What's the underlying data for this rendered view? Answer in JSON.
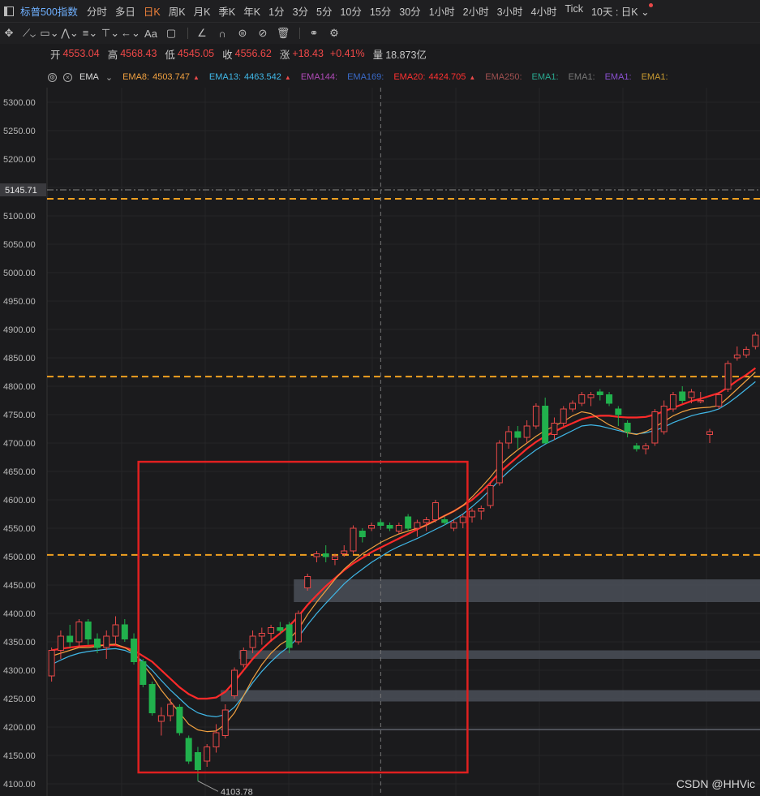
{
  "toolbar": {
    "title": "标普500指数",
    "timeframes": [
      "分时",
      "多日",
      "日K",
      "周K",
      "月K",
      "季K",
      "年K",
      "1分",
      "3分",
      "5分",
      "10分",
      "15分",
      "30分",
      "1小时",
      "2小时",
      "3小时",
      "4小时",
      "Tick"
    ],
    "active_timeframe": "日K",
    "range": "10天 : 日K"
  },
  "tools": [
    "move-icon",
    "line-icon",
    "rect-icon",
    "pattern-icon",
    "channel-icon",
    "fib-icon",
    "arrow-icon",
    "text-icon",
    "comment-icon",
    "ruler-icon",
    "magnet-icon",
    "visibility-icon",
    "hide-icon",
    "trash-icon",
    "link-icon",
    "settings-icon"
  ],
  "quote": {
    "open_label": "开",
    "open": "4553.04",
    "high_label": "高",
    "high": "4568.43",
    "low_label": "低",
    "low": "4545.05",
    "close_label": "收",
    "close": "4556.62",
    "change_label": "涨",
    "change": "+18.43",
    "change_pct": "+0.41%",
    "volume_label": "量",
    "volume": "18.873亿"
  },
  "indicator": {
    "name": "EMA",
    "items": [
      {
        "label": "EMA8:",
        "value": "4503.747",
        "color": "#f0a040",
        "arrow": true
      },
      {
        "label": "EMA13:",
        "value": "4463.542",
        "color": "#40b8e8",
        "arrow": true
      },
      {
        "label": "EMA144:",
        "value": "",
        "color": "#b04ab8",
        "arrow": false
      },
      {
        "label": "EMA169:",
        "value": "",
        "color": "#3a6ac8",
        "arrow": false
      },
      {
        "label": "EMA20:",
        "value": "4424.705",
        "color": "#ff3030",
        "arrow": true
      },
      {
        "label": "EMA250:",
        "value": "",
        "color": "#a05050",
        "arrow": false
      },
      {
        "label": "EMA1:",
        "value": "",
        "color": "#2aa890",
        "arrow": false
      },
      {
        "label": "EMA1:",
        "value": "",
        "color": "#777777",
        "arrow": false
      },
      {
        "label": "EMA1:",
        "value": "",
        "color": "#8a50d0",
        "arrow": false
      },
      {
        "label": "EMA1:",
        "value": "",
        "color": "#c89a30",
        "arrow": false
      }
    ]
  },
  "chart_data": {
    "type": "candlestick",
    "ylim": [
      4100,
      5300
    ],
    "yticks": [
      "5300.00",
      "5250.00",
      "5200.00",
      "5150.00",
      "5100.00",
      "5050.00",
      "5000.00",
      "4950.00",
      "4900.00",
      "4850.00",
      "4800.00",
      "4750.00",
      "4700.00",
      "4650.00",
      "4600.00",
      "4550.00",
      "4500.00",
      "4450.00",
      "4400.00",
      "4350.00",
      "4300.00",
      "4250.00",
      "4200.00",
      "4150.00",
      "4100.00"
    ],
    "current_price_label": "5145.71",
    "current_price": 5145.71,
    "low_annotation": "4103.78",
    "low_value": 4103.78,
    "up_color": "#e84848",
    "down_color": "#21b14d",
    "candles": [
      [
        4290,
        4340,
        4280,
        4335
      ],
      [
        4335,
        4370,
        4320,
        4360
      ],
      [
        4360,
        4380,
        4340,
        4350
      ],
      [
        4350,
        4390,
        4340,
        4385
      ],
      [
        4385,
        4390,
        4345,
        4355
      ],
      [
        4355,
        4365,
        4330,
        4340
      ],
      [
        4340,
        4370,
        4320,
        4360
      ],
      [
        4360,
        4395,
        4345,
        4380
      ],
      [
        4380,
        4390,
        4350,
        4355
      ],
      [
        4355,
        4365,
        4310,
        4315
      ],
      [
        4315,
        4320,
        4270,
        4275
      ],
      [
        4275,
        4280,
        4220,
        4225
      ],
      [
        4210,
        4235,
        4185,
        4220
      ],
      [
        4220,
        4250,
        4210,
        4240
      ],
      [
        4235,
        4240,
        4185,
        4190
      ],
      [
        4180,
        4185,
        4135,
        4140
      ],
      [
        4155,
        4165,
        4105,
        4125
      ],
      [
        4140,
        4170,
        4130,
        4165
      ],
      [
        4165,
        4205,
        4155,
        4190
      ],
      [
        4185,
        4240,
        4180,
        4230
      ],
      [
        4255,
        4305,
        4250,
        4300
      ],
      [
        4310,
        4340,
        4305,
        4335
      ],
      [
        4340,
        4370,
        4330,
        4360
      ],
      [
        4360,
        4375,
        4345,
        4365
      ],
      [
        4365,
        4380,
        4350,
        4375
      ],
      [
        4375,
        4385,
        4365,
        4370
      ],
      [
        4380,
        4385,
        4330,
        4340
      ],
      [
        4350,
        4405,
        4345,
        4400
      ],
      [
        4445,
        4470,
        4440,
        4465
      ],
      [
        4500,
        4510,
        4490,
        4505
      ],
      [
        4505,
        4520,
        4490,
        4500
      ],
      [
        4495,
        4505,
        4485,
        4500
      ],
      [
        4505,
        4520,
        4500,
        4510
      ],
      [
        4510,
        4555,
        4505,
        4550
      ],
      [
        4545,
        4550,
        4525,
        4535
      ],
      [
        4550,
        4560,
        4545,
        4555
      ],
      [
        4560,
        4565,
        4550,
        4555
      ],
      [
        4555,
        4560,
        4545,
        4550
      ],
      [
        4545,
        4560,
        4540,
        4555
      ],
      [
        4570,
        4575,
        4545,
        4550
      ],
      [
        4550,
        4565,
        4535,
        4560
      ],
      [
        4560,
        4570,
        4545,
        4565
      ],
      [
        4565,
        4600,
        4560,
        4595
      ],
      [
        4565,
        4570,
        4555,
        4560
      ],
      [
        4550,
        4565,
        4545,
        4560
      ],
      [
        4560,
        4575,
        4550,
        4570
      ],
      [
        4570,
        4585,
        4560,
        4580
      ],
      [
        4580,
        4590,
        4565,
        4585
      ],
      [
        4590,
        4630,
        4585,
        4625
      ],
      [
        4630,
        4705,
        4625,
        4700
      ],
      [
        4700,
        4730,
        4690,
        4720
      ],
      [
        4720,
        4730,
        4690,
        4710
      ],
      [
        4710,
        4740,
        4700,
        4730
      ],
      [
        4730,
        4770,
        4725,
        4765
      ],
      [
        4765,
        4780,
        4700,
        4700
      ],
      [
        4715,
        4745,
        4705,
        4735
      ],
      [
        4735,
        4765,
        4730,
        4760
      ],
      [
        4760,
        4775,
        4755,
        4770
      ],
      [
        4770,
        4790,
        4765,
        4785
      ],
      [
        4780,
        4790,
        4765,
        4785
      ],
      [
        4790,
        4795,
        4775,
        4785
      ],
      [
        4785,
        4790,
        4765,
        4770
      ],
      [
        4760,
        4765,
        4730,
        4750
      ],
      [
        4735,
        4740,
        4710,
        4720
      ],
      [
        4695,
        4700,
        4685,
        4690
      ],
      [
        4690,
        4700,
        4680,
        4695
      ],
      [
        4700,
        4760,
        4695,
        4755
      ],
      [
        4720,
        4775,
        4715,
        4765
      ],
      [
        4760,
        4790,
        4755,
        4785
      ],
      [
        4790,
        4800,
        4770,
        4775
      ],
      [
        4780,
        4795,
        4770,
        4790
      ],
      [
        4775,
        4790,
        4770,
        4775
      ],
      [
        4715,
        4725,
        4700,
        4720
      ],
      [
        4765,
        4790,
        4760,
        4785
      ],
      [
        4795,
        4845,
        4790,
        4840
      ],
      [
        4850,
        4870,
        4845,
        4855
      ],
      [
        4855,
        4870,
        4850,
        4865
      ],
      [
        4870,
        4895,
        4865,
        4890
      ]
    ],
    "ema8": [
      4325,
      4330,
      4335,
      4340,
      4340,
      4342,
      4345,
      4346,
      4340,
      4330,
      4310,
      4290,
      4265,
      4245,
      4225,
      4205,
      4195,
      4192,
      4193,
      4205,
      4225,
      4255,
      4285,
      4310,
      4330,
      4345,
      4355,
      4372,
      4398,
      4420,
      4440,
      4460,
      4478,
      4492,
      4505,
      4515,
      4525,
      4533,
      4540,
      4545,
      4550,
      4555,
      4563,
      4572,
      4580,
      4590,
      4605,
      4622,
      4640,
      4660,
      4675,
      4688,
      4700,
      4712,
      4722,
      4730,
      4738,
      4748,
      4755,
      4752,
      4742,
      4732,
      4725,
      4718,
      4715,
      4720,
      4728,
      4738,
      4748,
      4755,
      4760,
      4762,
      4763,
      4766,
      4780,
      4795,
      4810,
      4825
    ],
    "ema13": [
      4310,
      4318,
      4325,
      4330,
      4333,
      4335,
      4337,
      4338,
      4335,
      4328,
      4315,
      4300,
      4282,
      4265,
      4250,
      4235,
      4225,
      4220,
      4218,
      4222,
      4235,
      4255,
      4278,
      4298,
      4315,
      4330,
      4342,
      4358,
      4380,
      4400,
      4418,
      4435,
      4452,
      4466,
      4478,
      4490,
      4500,
      4510,
      4518,
      4525,
      4532,
      4540,
      4548,
      4556,
      4565,
      4575,
      4588,
      4602,
      4618,
      4635,
      4650,
      4664,
      4676,
      4688,
      4698,
      4706,
      4714,
      4722,
      4730,
      4732,
      4730,
      4726,
      4722,
      4718,
      4716,
      4718,
      4722,
      4728,
      4736,
      4742,
      4748,
      4752,
      4755,
      4760,
      4770,
      4782,
      4795,
      4808
    ],
    "ema20": [
      4335,
      4338,
      4340,
      4342,
      4343,
      4344,
      4344,
      4344,
      4340,
      4335,
      4325,
      4315,
      4300,
      4285,
      4270,
      4258,
      4250,
      4250,
      4252,
      4262,
      4280,
      4300,
      4320,
      4337,
      4352,
      4365,
      4378,
      4395,
      4415,
      4432,
      4448,
      4462,
      4476,
      4488,
      4498,
      4508,
      4516,
      4524,
      4532,
      4540,
      4548,
      4556,
      4564,
      4572,
      4580,
      4590,
      4600,
      4614,
      4630,
      4648,
      4662,
      4676,
      4690,
      4702,
      4712,
      4720,
      4728,
      4735,
      4742,
      4746,
      4748,
      4748,
      4746,
      4745,
      4745,
      4746,
      4750,
      4756,
      4762,
      4768,
      4774,
      4778,
      4783,
      4788,
      4798,
      4810,
      4820,
      4832
    ],
    "hlines_orange": [
      5130,
      4817,
      4503
    ],
    "zones": [
      {
        "from": 4420,
        "to": 4460,
        "x_start_idx": 27
      },
      {
        "from": 4320,
        "to": 4335,
        "x_start_idx": 21
      },
      {
        "from": 4245,
        "to": 4265,
        "x_start_idx": 19
      },
      {
        "from": 4195,
        "to": 4197,
        "x_start_idx": 19
      }
    ],
    "highlight_box": {
      "from_idx": 10,
      "to_idx": 45,
      "ymin": 4120,
      "ymax": 4667
    },
    "crosshair_idx": 36
  },
  "watermark": "CSDN @HHVic"
}
